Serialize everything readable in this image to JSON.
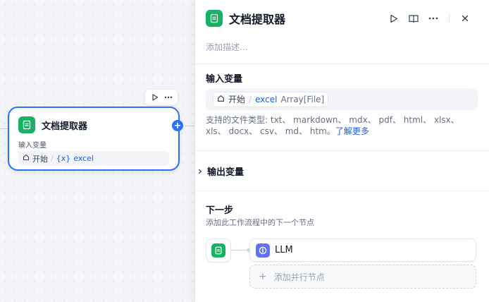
{
  "node": {
    "title": "文档提取器",
    "input_label": "输入变量",
    "var_source": "开始",
    "var_separator": "/",
    "var_prefix": "{x}",
    "var_name": "excel"
  },
  "panel": {
    "title": "文档提取器",
    "description_placeholder": "添加描述...",
    "input_section": {
      "title": "输入变量",
      "var_source": "开始",
      "var_separator": "/",
      "var_name": "excel",
      "var_type": "Array[File]"
    },
    "supported_types_text": "支持的文件类型: txt、 markdown、 mdx、 pdf、 html、 xlsx、 xls、 docx、 csv、 md、 htm。",
    "learn_more": "了解更多",
    "output_section": {
      "title": "输出变量"
    },
    "next_step": {
      "title": "下一步",
      "subtitle": "添加此工作流程中的下一个节点",
      "next_node_label": "LLM",
      "add_parallel_label": "添加并行节点"
    }
  },
  "icons": {
    "app": "document-extractor-icon",
    "run": "play-icon",
    "more": "more-horizontal-icon",
    "book": "book-open-icon",
    "close": "close-icon",
    "home": "home-icon",
    "chevron": "chevron-right-icon",
    "llm": "llm-icon",
    "plus": "plus-icon"
  },
  "colors": {
    "accent": "#2970ff",
    "app_icon": "#16b364",
    "llm_icon": "#6172f3",
    "link": "#155eef"
  }
}
